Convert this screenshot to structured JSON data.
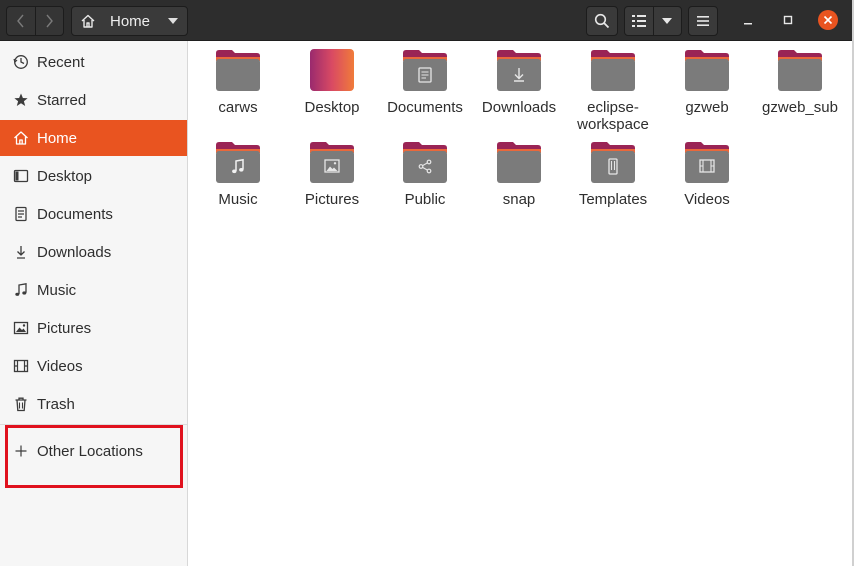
{
  "header": {
    "path_label": "Home"
  },
  "sidebar": {
    "items": [
      {
        "label": "Recent",
        "icon": "clock-icon"
      },
      {
        "label": "Starred",
        "icon": "star-icon"
      },
      {
        "label": "Home",
        "icon": "home-icon",
        "active": true
      },
      {
        "label": "Desktop",
        "icon": "desktop-icon"
      },
      {
        "label": "Documents",
        "icon": "document-icon"
      },
      {
        "label": "Downloads",
        "icon": "download-icon"
      },
      {
        "label": "Music",
        "icon": "music-icon"
      },
      {
        "label": "Pictures",
        "icon": "picture-icon"
      },
      {
        "label": "Videos",
        "icon": "video-icon"
      },
      {
        "label": "Trash",
        "icon": "trash-icon"
      }
    ],
    "other_locations": "Other Locations"
  },
  "files": [
    {
      "name": "carws",
      "glyph": ""
    },
    {
      "name": "Desktop",
      "glyph": "desktop"
    },
    {
      "name": "Documents",
      "glyph": "document"
    },
    {
      "name": "Downloads",
      "glyph": "download"
    },
    {
      "name": "eclipse-\nworkspace",
      "glyph": ""
    },
    {
      "name": "gzweb",
      "glyph": ""
    },
    {
      "name": "gzweb_sub",
      "glyph": ""
    },
    {
      "name": "Music",
      "glyph": "music"
    },
    {
      "name": "Pictures",
      "glyph": "picture"
    },
    {
      "name": "Public",
      "glyph": "share"
    },
    {
      "name": "snap",
      "glyph": ""
    },
    {
      "name": "Templates",
      "glyph": "template"
    },
    {
      "name": "Videos",
      "glyph": "video"
    }
  ],
  "colors": {
    "accent": "#e95420",
    "header_bg": "#2d2d2d",
    "folder_tab": "#9a2455",
    "folder_body": "#7a7a7a",
    "highlight_box": "#e0111e"
  }
}
